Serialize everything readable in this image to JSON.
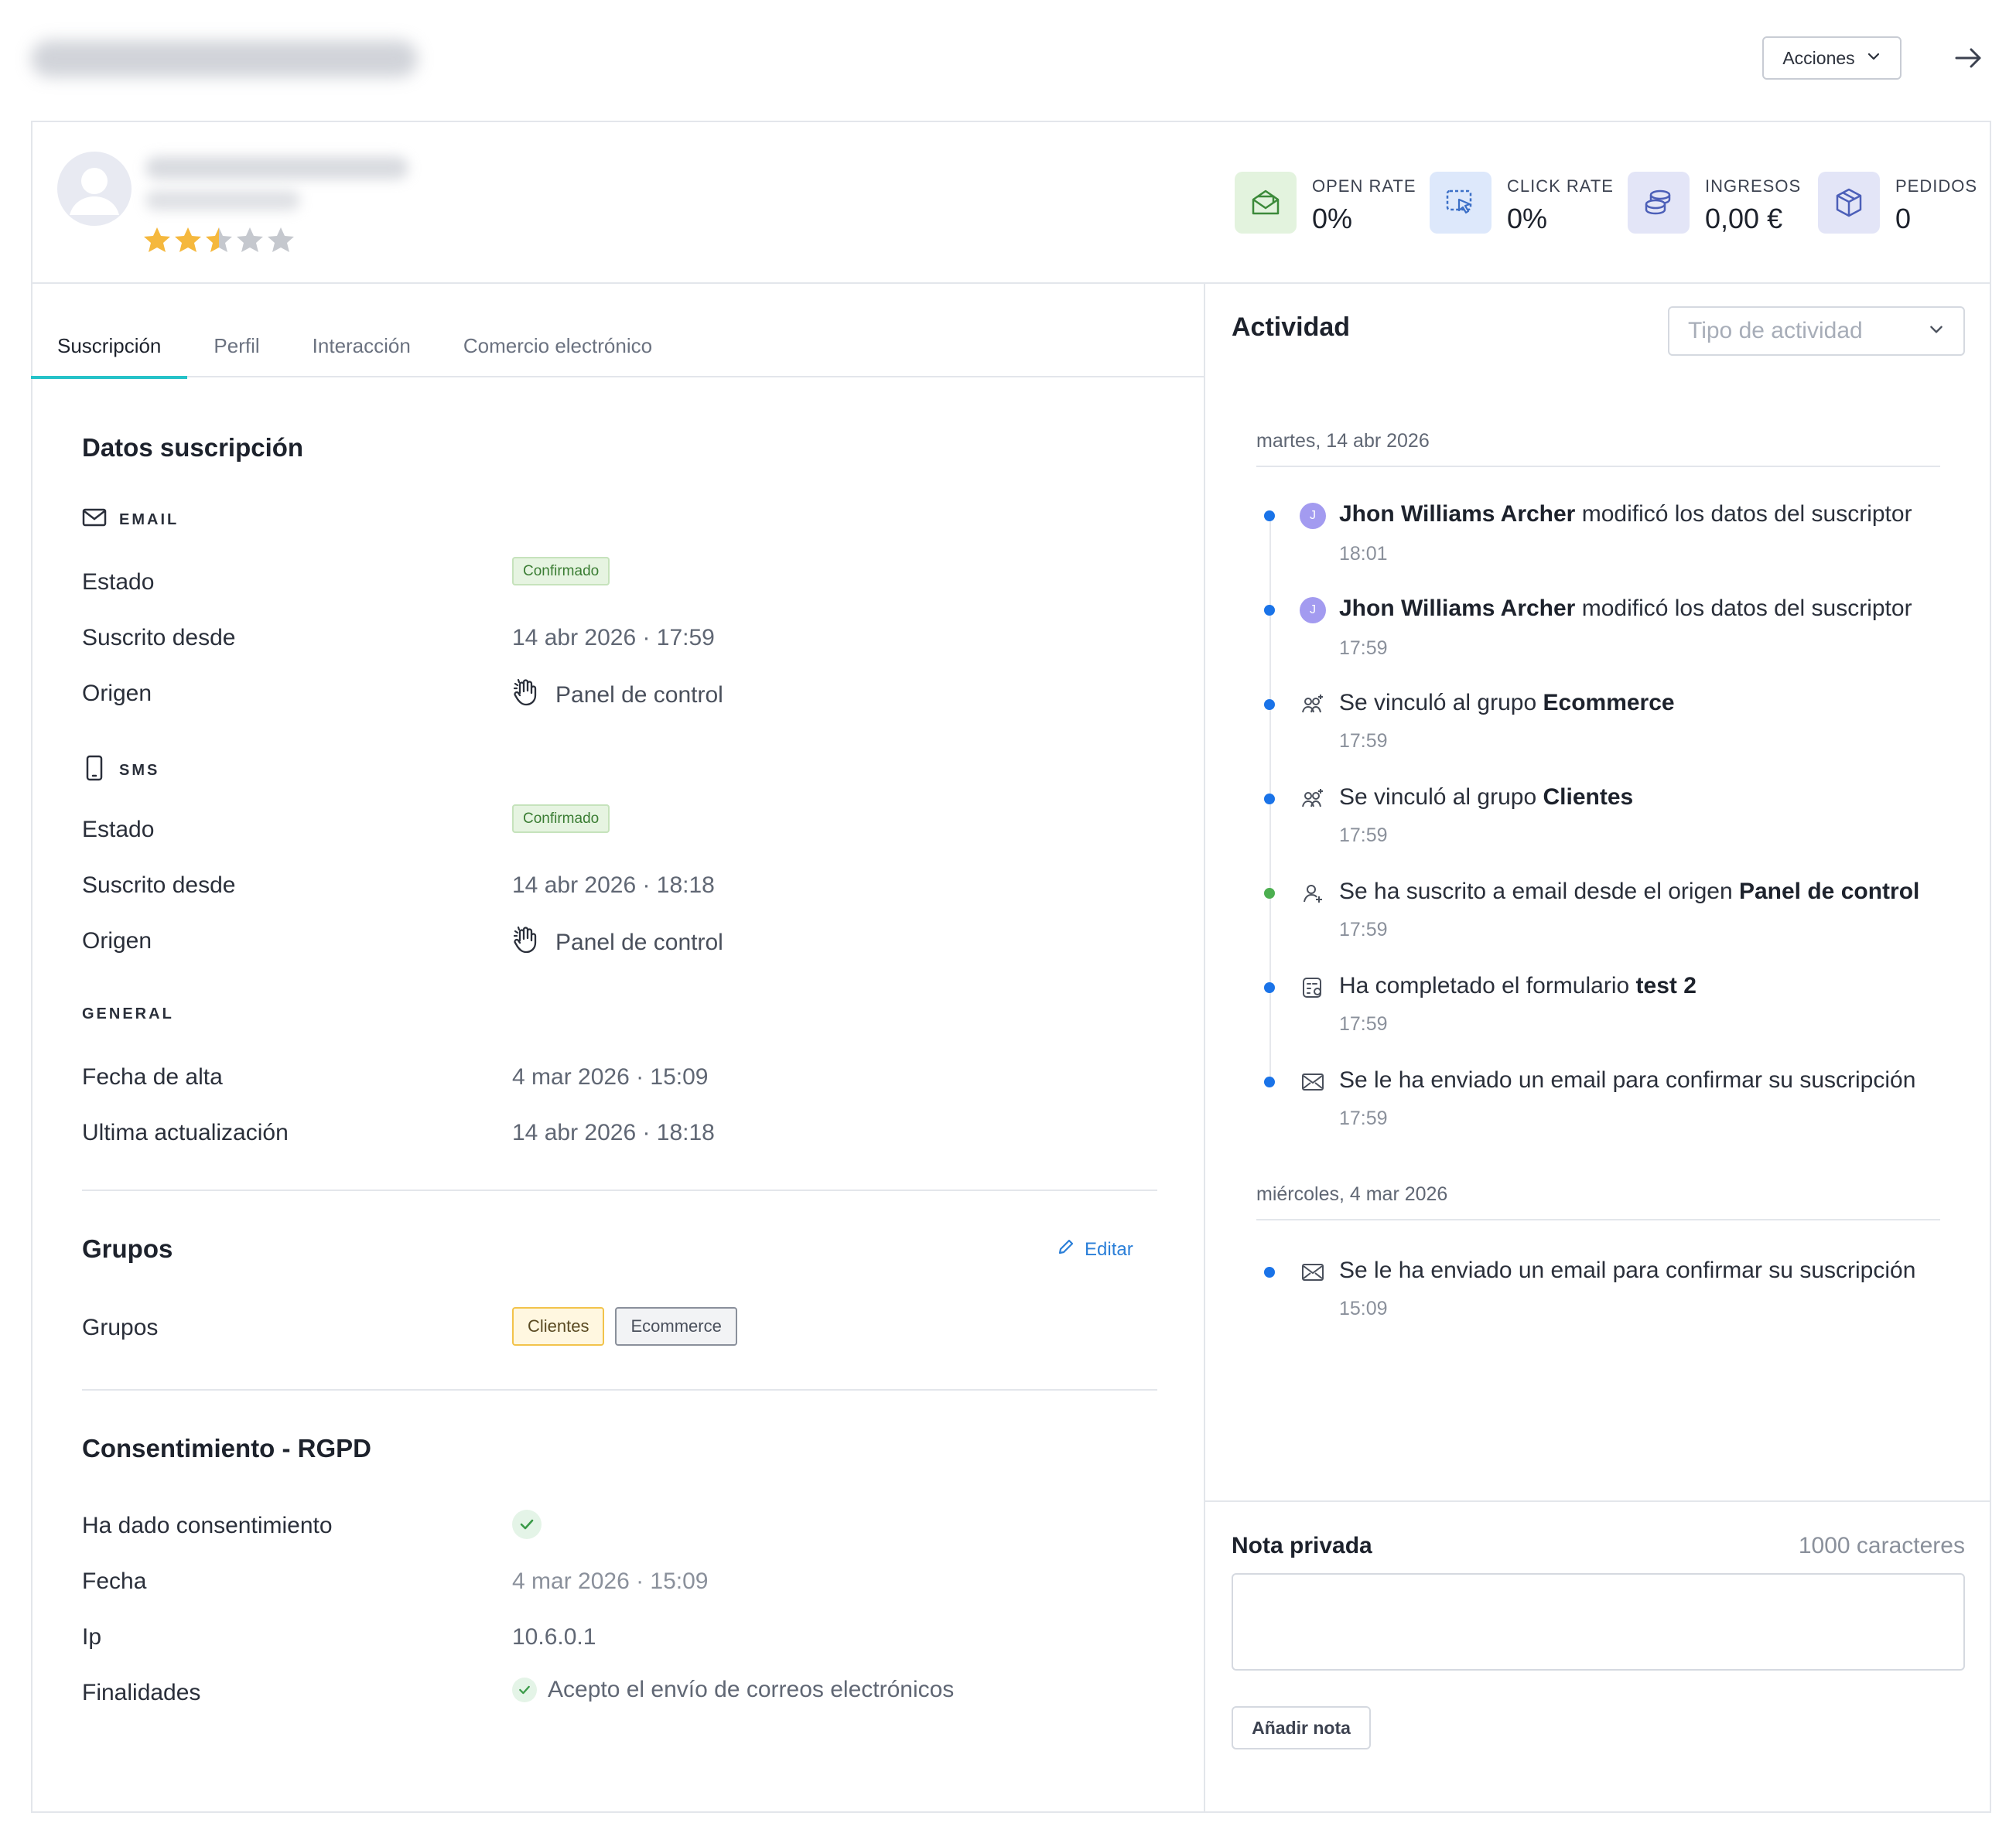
{
  "topbar": {
    "actions_label": "Acciones"
  },
  "metrics": [
    {
      "label": "OPEN RATE",
      "value": "0%",
      "icon": "open-mail-icon",
      "bg": "#e3f3de",
      "color": "#3c8a3a"
    },
    {
      "label": "CLICK RATE",
      "value": "0%",
      "icon": "cursor-click-icon",
      "bg": "#dde8fb",
      "color": "#3b6fc7"
    },
    {
      "label": "INGRESOS",
      "value": "0,00 €",
      "icon": "coins-icon",
      "bg": "#e3e5f7",
      "color": "#4c5fb8"
    },
    {
      "label": "PEDIDOS",
      "value": "0",
      "icon": "package-icon",
      "bg": "#e3e5f7",
      "color": "#4c5fb8"
    }
  ],
  "rating": {
    "value": 2.5,
    "max": 5
  },
  "tabs": [
    "Suscripción",
    "Perfil",
    "Interacción",
    "Comercio electrónico"
  ],
  "subscription": {
    "title": "Datos suscripción",
    "email": {
      "label": "EMAIL",
      "estado_label": "Estado",
      "estado": "Confirmado",
      "desde_label": "Suscrito desde",
      "desde": "14 abr 2026 · 17:59",
      "origen_label": "Origen",
      "origen": "Panel de control"
    },
    "sms": {
      "label": "SMS",
      "estado_label": "Estado",
      "estado": "Confirmado",
      "desde_label": "Suscrito desde",
      "desde": "14 abr 2026 · 18:18",
      "origen_label": "Origen",
      "origen": "Panel de control"
    },
    "general": {
      "label": "GENERAL",
      "alta_label": "Fecha de alta",
      "alta": "4 mar 2026 · 15:09",
      "update_label": "Ultima actualización",
      "update": "14 abr 2026 · 18:18"
    }
  },
  "groups": {
    "title": "Grupos",
    "edit_label": "Editar",
    "row_label": "Grupos",
    "items": [
      "Clientes",
      "Ecommerce"
    ]
  },
  "consent": {
    "title": "Consentimiento - RGPD",
    "given_label": "Ha dado consentimiento",
    "date_label": "Fecha",
    "date": "4 mar 2026 · 15:09",
    "ip_label": "Ip",
    "ip": "10.6.0.1",
    "purposes_label": "Finalidades",
    "purpose": "Acepto el envío de correos electrónicos"
  },
  "activity": {
    "title": "Actividad",
    "filter_placeholder": "Tipo de actividad",
    "day1": "martes, 14 abr 2026",
    "day2": "miércoles, 4 mar 2026",
    "events": [
      {
        "pre": "",
        "bold1": "Jhon Williams Archer",
        "post": " modificó los datos del suscriptor",
        "time": "18:01",
        "avatar": "J"
      },
      {
        "pre": "",
        "bold1": "Jhon Williams Archer",
        "post": " modificó los datos del suscriptor",
        "time": "17:59",
        "avatar": "J"
      },
      {
        "pre": "Se vinculó al grupo ",
        "bold1": "Ecommerce",
        "post": "",
        "time": "17:59"
      },
      {
        "pre": "Se vinculó al grupo ",
        "bold1": "Clientes",
        "post": "",
        "time": "17:59"
      },
      {
        "pre": "Se ha suscrito a email desde el origen ",
        "bold1": "Panel de control",
        "post": "",
        "time": "17:59"
      },
      {
        "pre": "Ha completado el formulario ",
        "bold1": "test 2",
        "post": "",
        "time": "17:59"
      },
      {
        "pre": "Se le ha enviado un email para confirmar su suscripción",
        "bold1": "",
        "post": "",
        "time": "17:59"
      },
      {
        "pre": "Se le ha enviado un email para confirmar su suscripción",
        "bold1": "",
        "post": "",
        "time": "15:09"
      }
    ]
  },
  "note": {
    "title": "Nota privada",
    "counter": "1000 caracteres",
    "button": "Añadir nota"
  }
}
